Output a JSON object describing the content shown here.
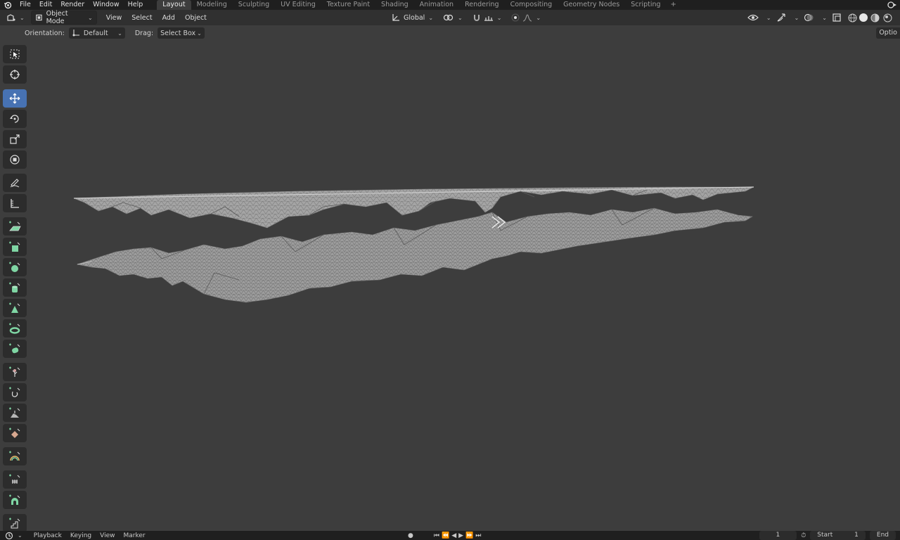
{
  "topbar": {
    "menu": [
      "File",
      "Edit",
      "Render",
      "Window",
      "Help"
    ],
    "workspaces": [
      "Layout",
      "Modeling",
      "Sculpting",
      "UV Editing",
      "Texture Paint",
      "Shading",
      "Animation",
      "Rendering",
      "Compositing",
      "Geometry Nodes",
      "Scripting"
    ],
    "active_workspace": "Layout",
    "add_label": "+"
  },
  "header": {
    "mode": "Object Mode",
    "menus": [
      "View",
      "Select",
      "Add",
      "Object"
    ],
    "transform_orientation": "Global"
  },
  "tool_header": {
    "orientation_label": "Orientation:",
    "orientation_value": "Default",
    "drag_label": "Drag:",
    "drag_value": "Select Box",
    "options_label": "Optio"
  },
  "toolbar": {
    "tools": [
      {
        "name": "select-box-tool",
        "icon": "select-box-icon",
        "active": false
      },
      {
        "name": "cursor-tool",
        "icon": "cursor-icon",
        "active": false
      },
      {
        "name": "move-tool",
        "icon": "move-icon",
        "active": true
      },
      {
        "name": "rotate-tool",
        "icon": "rotate-icon",
        "active": false
      },
      {
        "name": "scale-tool",
        "icon": "scale-icon",
        "active": false
      },
      {
        "name": "transform-tool",
        "icon": "transform-icon",
        "active": false
      },
      {
        "name": "annotate-tool",
        "icon": "annotate-icon",
        "active": false
      },
      {
        "name": "measure-tool",
        "icon": "measure-icon",
        "active": false
      },
      {
        "name": "add-plane-tool",
        "icon": "add-plane-icon",
        "active": false
      },
      {
        "name": "add-cube-tool",
        "icon": "add-cube-icon",
        "active": false
      },
      {
        "name": "add-sphere-tool",
        "icon": "add-sphere-icon",
        "active": false
      },
      {
        "name": "add-cylinder-tool",
        "icon": "add-cylinder-icon",
        "active": false
      },
      {
        "name": "add-cone-tool",
        "icon": "add-cone-icon",
        "active": false
      },
      {
        "name": "add-torus-tool",
        "icon": "add-torus-icon",
        "active": false
      },
      {
        "name": "add-capsule-tool",
        "icon": "add-capsule-icon",
        "active": false
      },
      {
        "name": "add-grass-tool",
        "icon": "add-grass-icon",
        "active": false
      },
      {
        "name": "add-curve-tool",
        "icon": "add-curve-icon",
        "active": false
      },
      {
        "name": "add-rock-tool",
        "icon": "add-rock-icon",
        "active": false
      },
      {
        "name": "add-gem-tool",
        "icon": "add-gem-icon",
        "active": false
      },
      {
        "name": "add-rainbow-tool",
        "icon": "add-rainbow-icon",
        "active": false
      },
      {
        "name": "add-fence-tool",
        "icon": "add-fence-icon",
        "active": false
      },
      {
        "name": "add-arch-tool",
        "icon": "add-arch-icon",
        "active": false
      },
      {
        "name": "add-stairs-tool",
        "icon": "add-stairs-icon",
        "active": false
      }
    ]
  },
  "timeline": {
    "menus": [
      "Playback",
      "Keying",
      "View",
      "Marker"
    ],
    "current_frame": "1",
    "start_label": "Start",
    "start_value": "1",
    "end_label": "End"
  },
  "colors": {
    "accent": "#4772b3",
    "viewport_bg": "#3d3d3d",
    "mesh": "#a9a9a9",
    "tool_icon_green": "#7fd6a4"
  }
}
